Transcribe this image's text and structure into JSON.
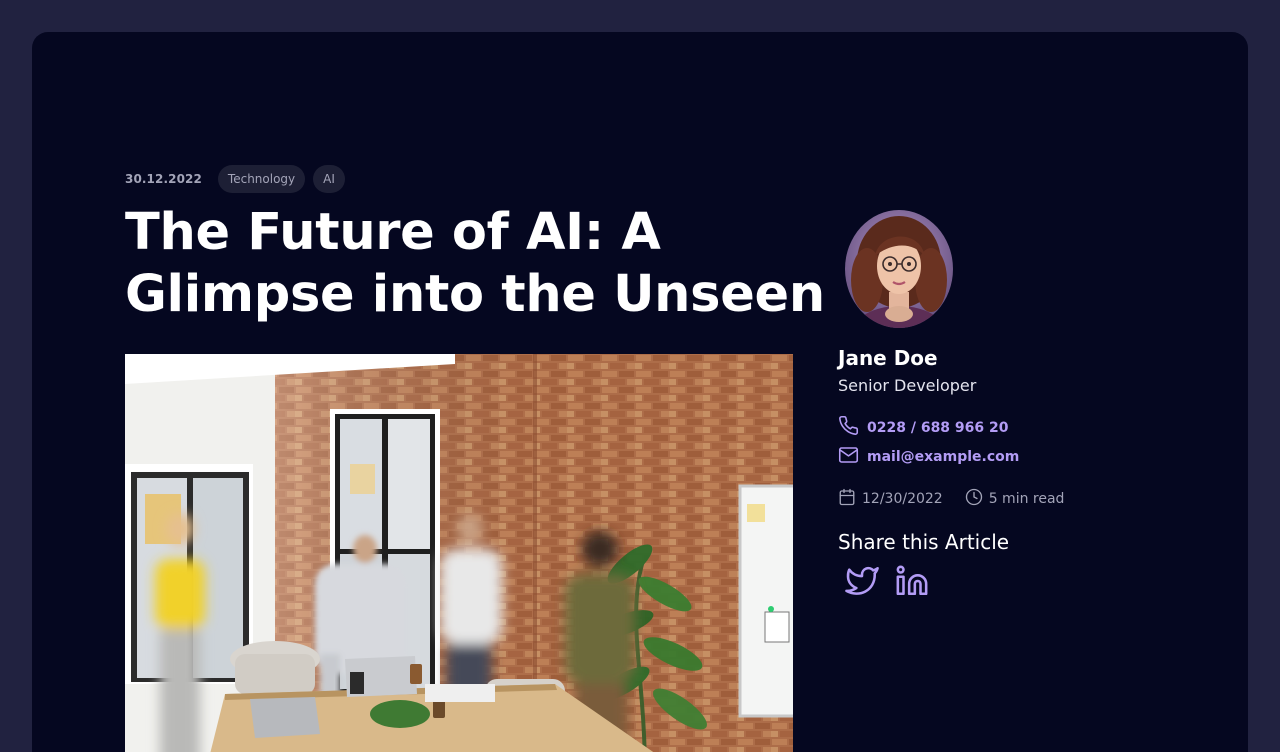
{
  "article": {
    "date": "30.12.2022",
    "tags": [
      "Technology",
      "AI"
    ],
    "title": "The Future of AI: A Glimpse into the Unseen"
  },
  "author": {
    "name": "Jane Doe",
    "role": "Senior Developer",
    "phone": "0228 / 688 966 20",
    "email": "mail@example.com"
  },
  "stats": {
    "published": "12/30/2022",
    "read_time": "5 min read"
  },
  "share": {
    "title": "Share this Article",
    "networks": [
      "twitter-icon",
      "linkedin-icon"
    ]
  },
  "colors": {
    "page_bg": "#212240",
    "card_bg": "#050720",
    "accent": "#b39cf5",
    "muted": "#a3a4b8"
  }
}
